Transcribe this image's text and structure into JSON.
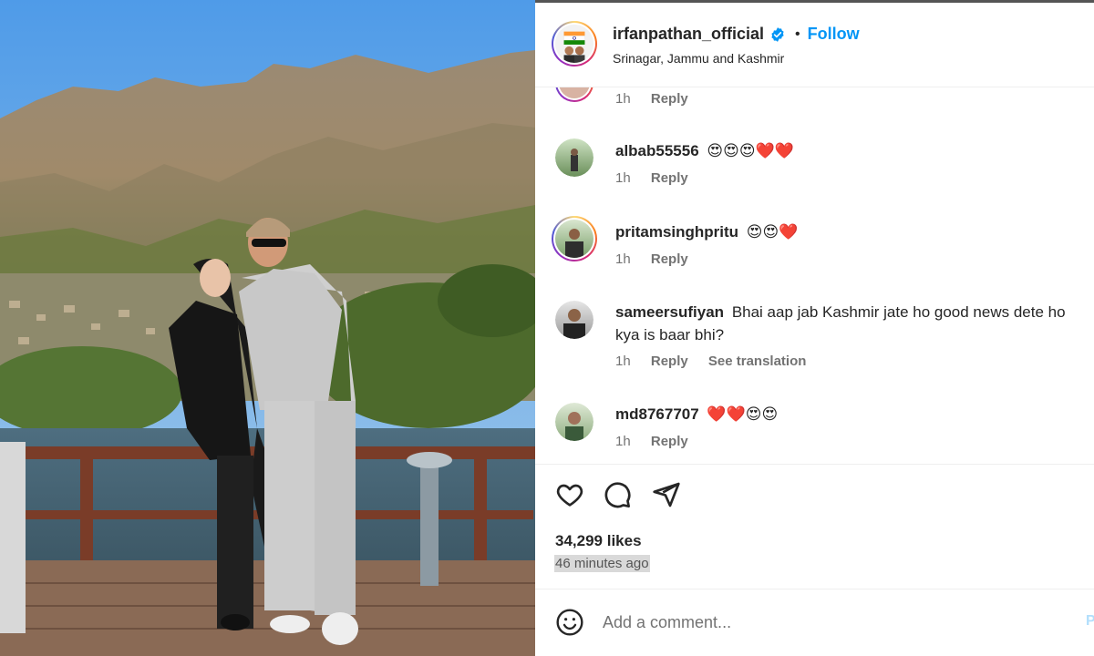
{
  "post": {
    "username": "irfanpathan_official",
    "verified": true,
    "separator": "•",
    "follow_label": "Follow",
    "location": "Srinagar, Jammu and Kashmir"
  },
  "comments": [
    {
      "username": "",
      "text": "",
      "time": "1h",
      "reply_label": "Reply",
      "partial": true
    },
    {
      "username": "albab55556",
      "text": "😍😍😍❤️❤️",
      "time": "1h",
      "reply_label": "Reply"
    },
    {
      "username": "pritamsinghpritu",
      "text": "😍😍❤️",
      "time": "1h",
      "reply_label": "Reply"
    },
    {
      "username": "sameersufiyan",
      "text": "Bhai aap jab Kashmir jate ho good news dete ho kya is baar bhi?",
      "time": "1h",
      "reply_label": "Reply",
      "translation_label": "See translation"
    },
    {
      "username": "md8767707",
      "text": "❤️❤️😍😍",
      "time": "1h",
      "reply_label": "Reply"
    }
  ],
  "actions": {
    "like_icon": "heart-outline-icon",
    "comment_icon": "comment-bubble-icon",
    "share_icon": "paper-plane-icon",
    "likes": "34,299 likes",
    "time_ago": "46 minutes ago"
  },
  "add_comment": {
    "emoji_icon": "smiley-icon",
    "placeholder": "Add a comment...",
    "post_label": "P"
  },
  "colors": {
    "accent": "#0095f6",
    "text": "#262626",
    "muted": "#737373",
    "heart": "#ed1c24"
  }
}
